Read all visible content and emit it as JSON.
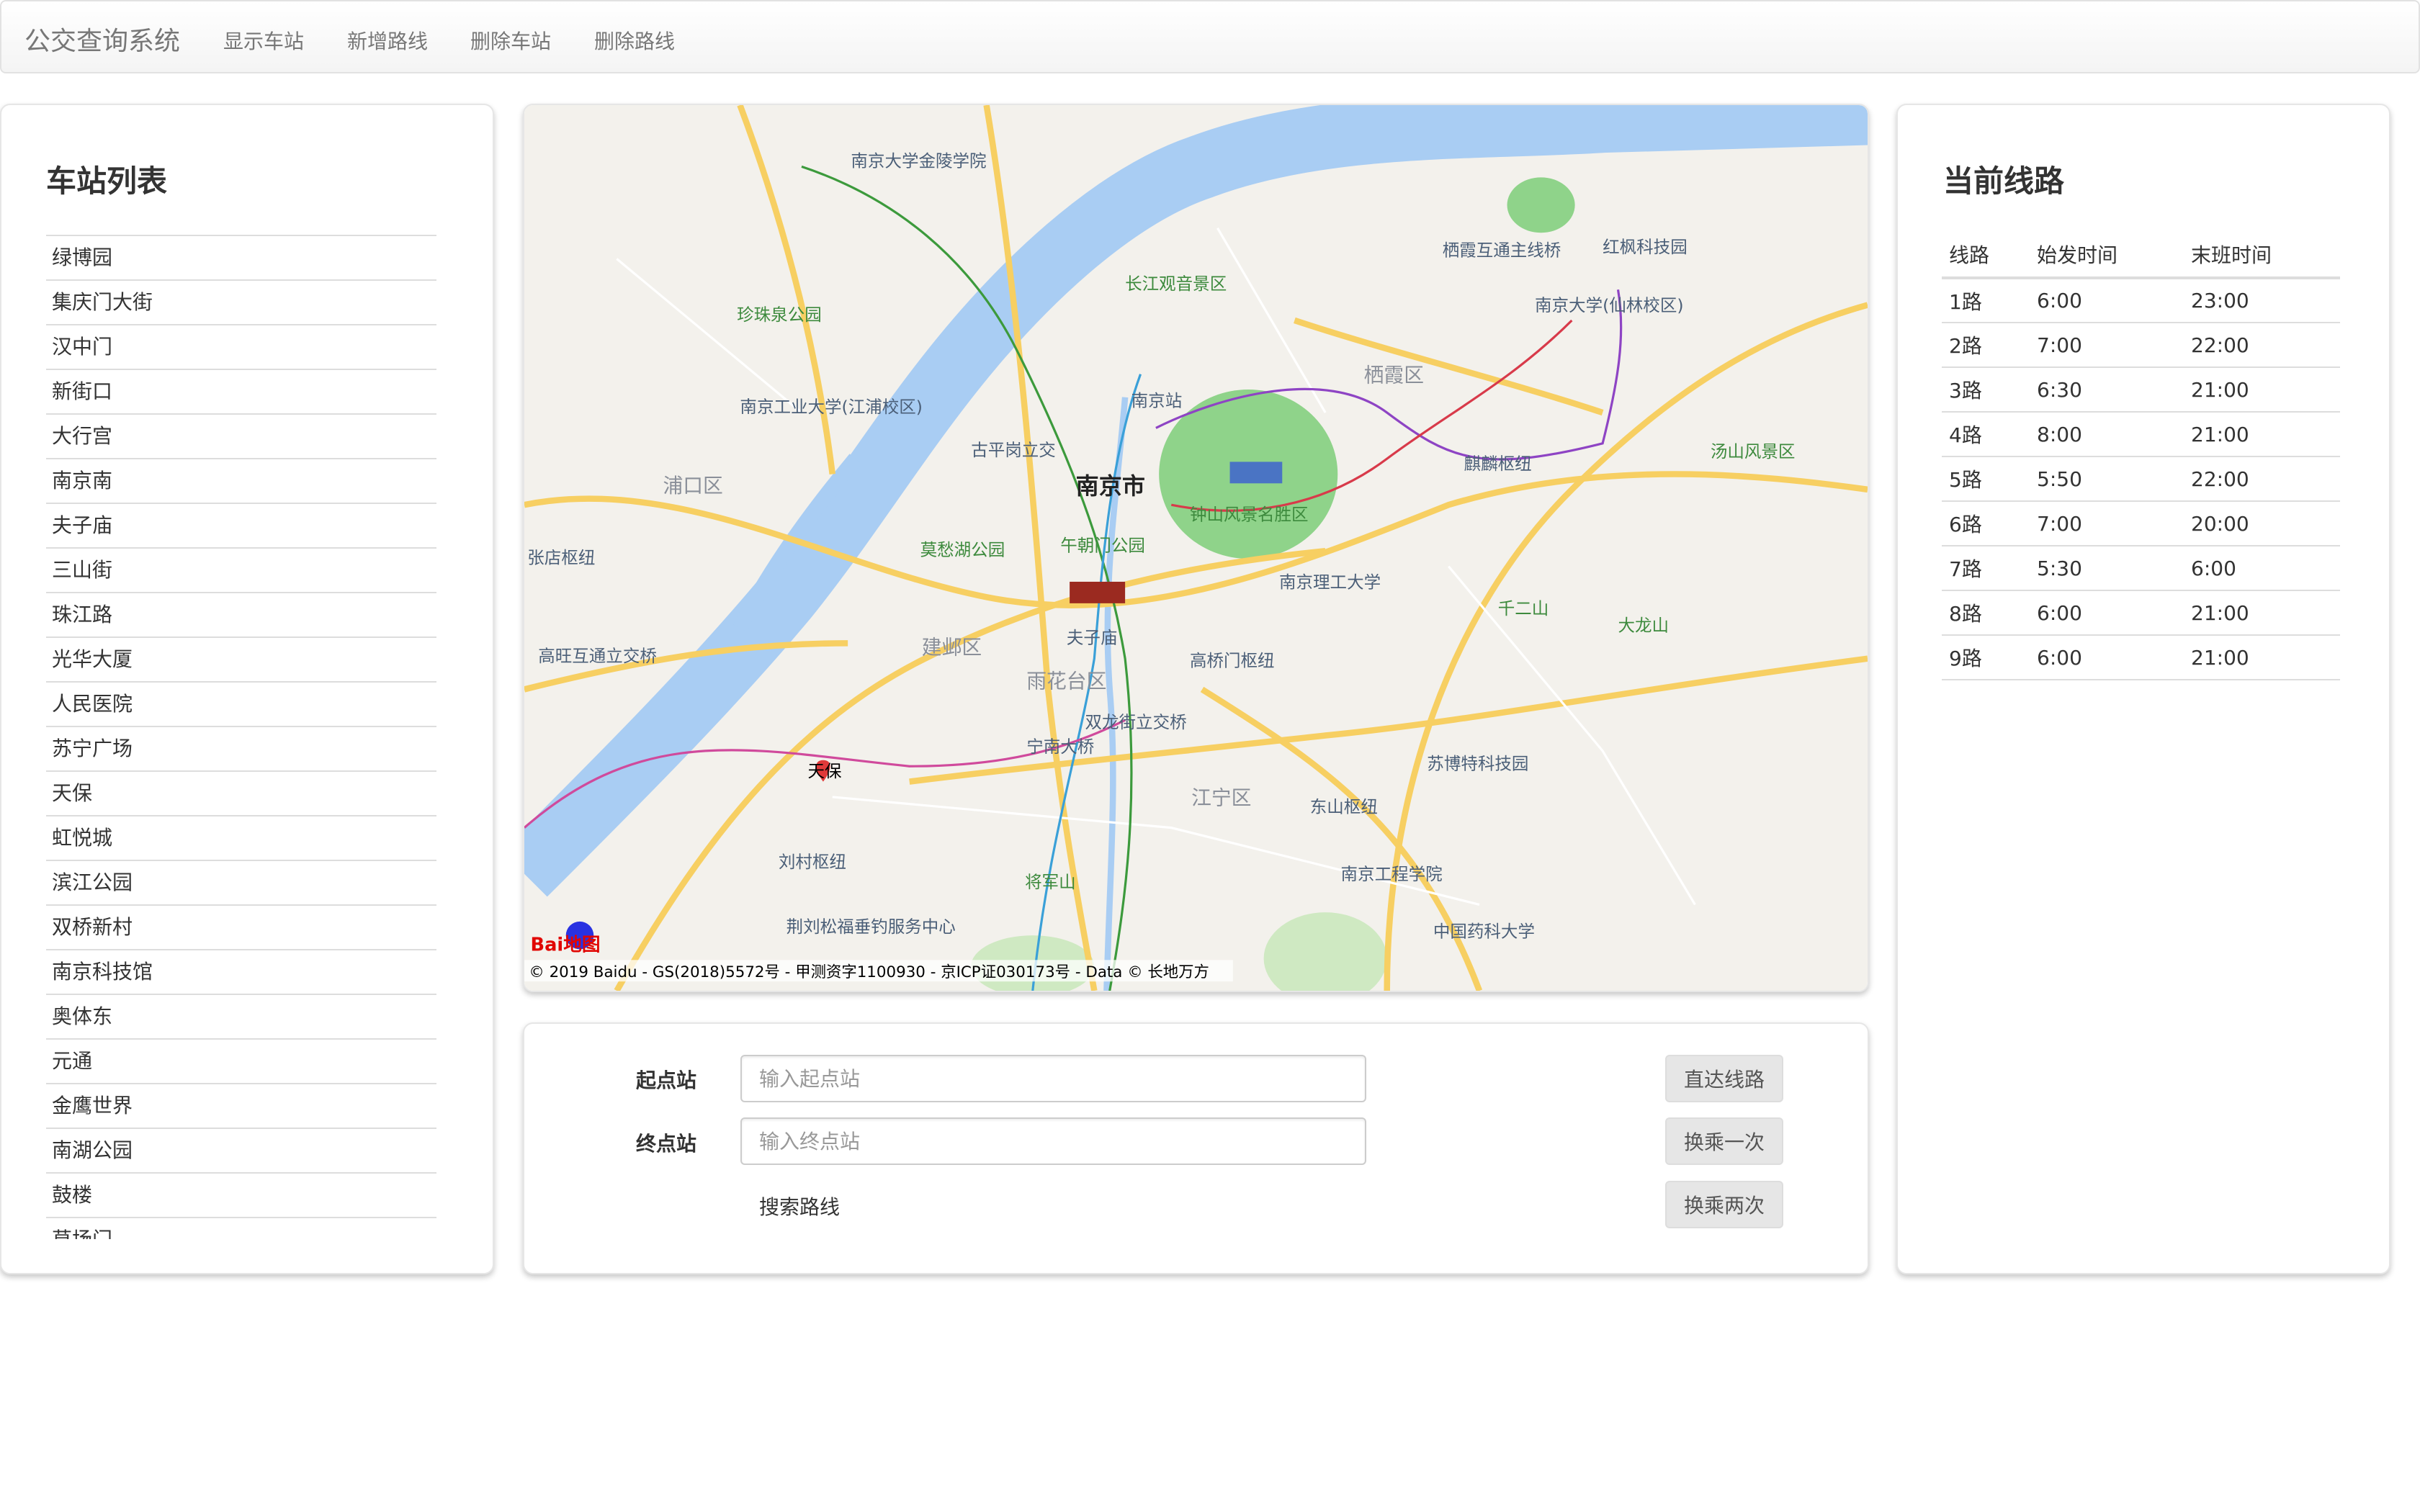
{
  "navbar": {
    "brand": "公交查询系统",
    "items": [
      "显示车站",
      "新增路线",
      "删除车站",
      "删除路线"
    ]
  },
  "stations": {
    "title": "车站列表",
    "items": [
      "绿博园",
      "集庆门大街",
      "汉中门",
      "新街口",
      "大行宫",
      "南京南",
      "夫子庙",
      "三山街",
      "珠江路",
      "光华大厦",
      "人民医院",
      "苏宁广场",
      "天保",
      "虹悦城",
      "滨江公园",
      "双桥新村",
      "南京科技馆",
      "奥体东",
      "元通",
      "金鹰世界",
      "南湖公园",
      "鼓楼",
      "草场门"
    ]
  },
  "routes": {
    "title": "当前线路",
    "headers": [
      "线路",
      "始发时间",
      "末班时间"
    ],
    "rows": [
      [
        "1路",
        "6:00",
        "23:00"
      ],
      [
        "2路",
        "7:00",
        "22:00"
      ],
      [
        "3路",
        "6:30",
        "21:00"
      ],
      [
        "4路",
        "8:00",
        "21:00"
      ],
      [
        "5路",
        "5:50",
        "22:00"
      ],
      [
        "6路",
        "7:00",
        "20:00"
      ],
      [
        "7路",
        "5:30",
        "6:00"
      ],
      [
        "8路",
        "6:00",
        "21:00"
      ],
      [
        "9路",
        "6:00",
        "21:00"
      ]
    ]
  },
  "search": {
    "start_label": "起点站",
    "start_placeholder": "输入起点站",
    "start_value": "",
    "end_label": "终点站",
    "end_placeholder": "输入终点站",
    "end_value": "",
    "search_text": "搜索路线",
    "buttons": [
      "直达线路",
      "换乘一次",
      "换乘两次"
    ]
  },
  "map": {
    "city": "南京市",
    "districts": [
      "浦口区",
      "建邺区",
      "雨花台区",
      "江宁区",
      "栖霞区"
    ],
    "labels": [
      "钟山风景名胜区",
      "南京站",
      "夫子庙",
      "长江观音景区",
      "南京大学(仙林校区)",
      "汤山风景区",
      "千二山",
      "大龙山",
      "东山枢纽",
      "将军山",
      "南京工程学院",
      "中国药科大学",
      "高桥门枢纽",
      "双龙街立交桥",
      "刘村枢纽",
      "张店枢纽",
      "高旺互通立交桥",
      "珍珠泉公园",
      "南京工业大学(江浦校区)",
      "莫愁湖公园",
      "午朝门公园",
      "南京理工大学",
      "栖霞互通主线桥",
      "红枫科技园",
      "苏博特科技园",
      "荆刘松福垂钓服务中心",
      "南京大学金陵学院",
      "古平岗立交",
      "麒麟枢纽",
      "宁南大桥"
    ],
    "marker_label": "天保",
    "logo_text": "Bai地图",
    "copyright": "© 2019 Baidu - GS(2018)5572号 - 甲测资字1100930 - 京ICP证030173号 - Data © 长地万方",
    "colors": {
      "water": "#a9cdf3",
      "land": "#f3f1ec",
      "park": "#b9e3a8",
      "road": "#f7cf62",
      "marker": "#e03a3a"
    }
  }
}
